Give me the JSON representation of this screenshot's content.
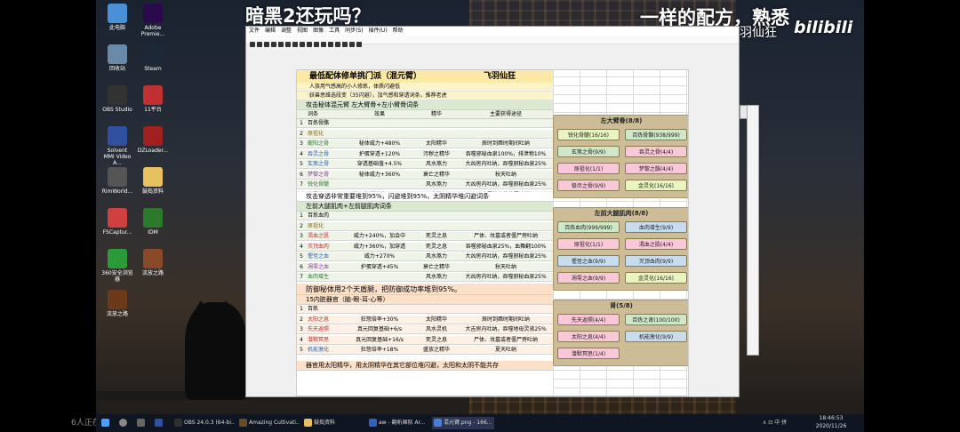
{
  "overlay": {
    "title": "暗黑2还玩吗？",
    "right_text": "一样的配方，熟悉",
    "channel_name": "羽仙狂",
    "logo": "bilibili",
    "watching": "6人正在看"
  },
  "desktop_icons": [
    {
      "label": "此电脑",
      "color": "#4a90d9"
    },
    {
      "label": "Adobe Premie...",
      "color": "#2a0a4a"
    },
    {
      "label": "回收站",
      "color": "#6a8aaa"
    },
    {
      "label": "Steam",
      "color": "#1b2838"
    },
    {
      "label": "OBS Studio",
      "color": "#333333"
    },
    {
      "label": "11平台",
      "color": "#c03030"
    },
    {
      "label": "Solvent MMI Video A...",
      "color": "#3050a0"
    },
    {
      "label": "DZLoader...",
      "color": "#a02020"
    },
    {
      "label": "RimWorld...",
      "color": "#555555"
    },
    {
      "label": "鼓捣资料",
      "color": "#e8c060"
    },
    {
      "label": "FSCaptur...",
      "color": "#d04040"
    },
    {
      "label": "IDM",
      "color": "#2a7a2a"
    },
    {
      "label": "360安全浏览器",
      "color": "#2a9a3a"
    },
    {
      "label": "流放之路",
      "color": "#8a4a2a"
    },
    {
      "label": "流放之路",
      "color": "#6a3a1a"
    }
  ],
  "viewer": {
    "menu": [
      "文件",
      "编辑",
      "调整",
      "视图",
      "图像",
      "工具",
      "同步(S)",
      "插件(U)",
      "帮助"
    ],
    "sheet": {
      "title": "最低配体修单挑门派（混元臂）",
      "author": "飞羽仙狂",
      "intro": [
        "人族用气感高的小人修炼，体质闪避低",
        "妖兽思维选段变（35闪避），加气感和穿透词条，推荐老虎"
      ],
      "section1": "攻击秘体混元臂 左大臂骨+左小臂骨词条",
      "headers": [
        "词条",
        "效果",
        "精华",
        "主要获得途径"
      ],
      "rows1": [
        {
          "n": "1",
          "name": "百炼骨骼",
          "effect": "",
          "ess": "",
          "src": "",
          "color": "#000000"
        },
        {
          "n": "2",
          "name": "原祖化",
          "effect": "",
          "ess": "",
          "src": "",
          "color": "#8a6a00"
        },
        {
          "n": "3",
          "name": "龍阳之骨",
          "effect": "秘体威力+480%",
          "ess": "太阳精华",
          "src": "辰时到酉时期间吐纳",
          "color": "#2a7a2a"
        },
        {
          "n": "4",
          "name": "吞灵之骨",
          "effect": "护蛋穿透+120%",
          "ess": "污秽之精华",
          "src": "吞噬邪秘血泉100%，排泄物10%",
          "color": "#3060b0"
        },
        {
          "n": "5",
          "name": "玄煞之骨",
          "effect": "穿透基础值+4.5%",
          "ess": "风水煞力",
          "src": "大凶房内吐纳，吞噬邪秘血泉25%",
          "color": "#3060b0"
        },
        {
          "n": "6",
          "name": "梦黎之骨",
          "effect": "秘体威力+360%",
          "ess": "衰亡之精华",
          "src": "秋天吐纳",
          "color": "#8a3aa0"
        },
        {
          "n": "7",
          "name": "锐化骨髓",
          "effect": "",
          "ess": "风水煞力",
          "src": "大凶房内吐纳，吞噬邪秘血泉25%",
          "color": "#2a7a2a"
        },
        {
          "n": "8",
          "name": "金灵化",
          "effect": "护蛋穿透基础+1.28%",
          "ess": "金精",
          "src": "金属性高的位置吐纳",
          "color": "#2a7a2a"
        }
      ],
      "note1": "攻击穿透非常重要堆到95%，闪避堆到95%，太阴精华堆闪避词条",
      "section2": "左前大腿肌肉+左前腿肌肉词条",
      "rows2": [
        {
          "n": "1",
          "name": "百炼血肉",
          "effect": "",
          "ess": "",
          "src": "",
          "color": "#000000"
        },
        {
          "n": "2",
          "name": "原祖化",
          "effect": "",
          "ess": "",
          "src": "",
          "color": "#8a6a00"
        },
        {
          "n": "3",
          "name": "渴血之肌",
          "effect": "威力+240%，加会中",
          "ess": "死灵之息",
          "src": "尸体、坟墓或者僵尸旁吐纳",
          "color": "#c03030"
        },
        {
          "n": "4",
          "name": "灭顶血肉",
          "effect": "威力+360%，加穿透",
          "ess": "死灵之息",
          "src": "吞噬邪秘血泉25%，血舞翻100%",
          "color": "#c03030"
        },
        {
          "n": "5",
          "name": "惺怪之血",
          "effect": "威力+270%",
          "ess": "风水煞力",
          "src": "大凶房内吐纳，吞噬邪秘血泉25%",
          "color": "#3060b0"
        },
        {
          "n": "6",
          "name": "凋零之血",
          "effect": "护蛋穿透+45%",
          "ess": "衰亡之精华",
          "src": "秋天吐纳",
          "color": "#8a3aa0"
        },
        {
          "n": "7",
          "name": "血肉增生",
          "effect": "",
          "ess": "风水煞力",
          "src": "大凶房内吐纳，吞噬邪秘血泉25%",
          "color": "#2a7a2a"
        },
        {
          "n": "8",
          "name": "金灵化",
          "effect": "护蛋穿透基础+1.28%",
          "ess": "金精",
          "src": "金属性高的位置吐纳",
          "color": "#2a7a2a"
        }
      ],
      "section3": "防御秘体用2个天盾腿，把防御成功率堆到95%。",
      "section3b": "15内脏器官（脑-眼-耳-心等）",
      "rows3": [
        {
          "n": "1",
          "name": "百炼",
          "effect": "",
          "ess": "",
          "src": "",
          "color": "#000000"
        },
        {
          "n": "2",
          "name": "太阳之息",
          "effect": "狂怒倍率+30%",
          "ess": "太阳精华",
          "src": "辰时到酉时期间吐纳",
          "color": "#c03030"
        },
        {
          "n": "3",
          "name": "先天返照",
          "effect": "真元回复基础+6/s",
          "ess": "风水灵机",
          "src": "大吉房内吐纳，吞噬地母灵液25%",
          "color": "#c03030"
        },
        {
          "n": "4",
          "name": "潜默冥思",
          "effect": "真元回复基础+16/s",
          "ess": "死灵之息",
          "src": "尸体、坟墓或者僵尸旁吐纳",
          "color": "#c03030"
        },
        {
          "n": "5",
          "name": "机能激化",
          "effect": "狂怒倍率+18%",
          "ess": "盛放之精华",
          "src": "夏天吐纳",
          "color": "#3060b0"
        }
      ],
      "note3": "器官用太阳精华，用太阴精华在其它部位堆闪避，太阳和太阴不能共存"
    },
    "panels": [
      {
        "title": "左大臂骨(8/8)",
        "buttons": [
          {
            "label": "锐化骨髓(16/16)",
            "color": "#e9f5c0"
          },
          {
            "label": "百炼骨骼(938/999)",
            "color": "#cfe8c8"
          },
          {
            "label": "玄煞之骨(9/9)",
            "color": "#cfe8c8"
          },
          {
            "label": "吞灵之骨(4/4)",
            "color": "#f8c8d8"
          },
          {
            "label": "原祖化(1/1)",
            "color": "#f8c8d8"
          },
          {
            "label": "梦黎之骸(4/4)",
            "color": "#f8c8d8"
          },
          {
            "label": "极尽之骨(9/9)",
            "color": "#f8c8d8"
          },
          {
            "label": "金灵化(16/16)",
            "color": "#e9f5c0"
          }
        ]
      },
      {
        "title": "左前大腿肌肉(8/8)",
        "buttons": [
          {
            "label": "百炼血肉(999/999)",
            "color": "#cfe8c8"
          },
          {
            "label": "血肉增生(9/9)",
            "color": "#c8dcf0"
          },
          {
            "label": "原祖化(1/1)",
            "color": "#f8c8d8"
          },
          {
            "label": "渴血之肌(4/4)",
            "color": "#f8c8d8"
          },
          {
            "label": "惺怪之血(9/9)",
            "color": "#c8dcf0"
          },
          {
            "label": "灭顶血肉(9/9)",
            "color": "#c8dcf0"
          },
          {
            "label": "凋零之血(9/9)",
            "color": "#f8c8d8"
          },
          {
            "label": "金灵化(16/16)",
            "color": "#e9f5c0"
          }
        ]
      },
      {
        "title": "肾(5/8)",
        "buttons": [
          {
            "label": "先天返照(4/4)",
            "color": "#f8c8d8"
          },
          {
            "label": "百炼之肾(100/100)",
            "color": "#cfe8c8"
          },
          {
            "label": "太阳之息(4/4)",
            "color": "#f8c8d8"
          },
          {
            "label": "机能激化(9/9)",
            "color": "#c8dcf0"
          },
          {
            "label": "潜默冥思(1/4)",
            "color": "#f8c8d8"
          }
        ]
      }
    ]
  },
  "taskbar": {
    "items": [
      "OBS 24.0.3 (64-bi...",
      "Amazing Cultivati...",
      "鼓捣资料",
      "aw - 翻析国际 Ar...",
      "混元臂.png - 166..."
    ],
    "tray": "∧  ⊡  中  拼",
    "time": "18:46:53",
    "date": "2020/11/26"
  }
}
